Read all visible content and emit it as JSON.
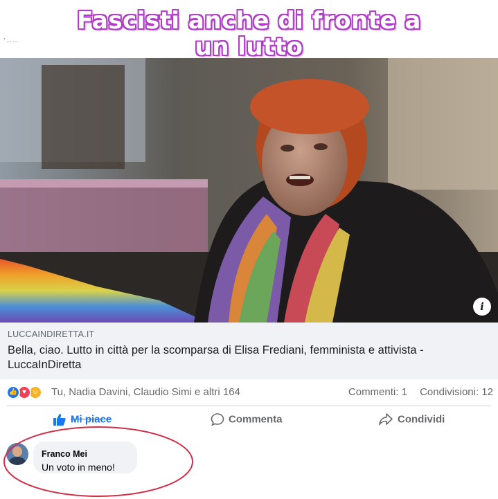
{
  "headline": {
    "line1": "Fascisti anche di fronte a",
    "line2": "un lutto",
    "tiny_text": "' ...  ..."
  },
  "post": {
    "link": {
      "domain": "LUCCAINDIRETTA.IT",
      "title": "Bella, ciao. Lutto in città per la scomparsa di Elisa Frediani, femminista e attivista - LuccaInDiretta",
      "info_icon": "info-icon"
    },
    "reactions": {
      "icons": [
        "like-icon",
        "love-icon",
        "care-icon"
      ],
      "names": "Tu, Nadia Davini, Claudio Simi e altri 164",
      "comments": "Commenti: 1",
      "shares": "Condivisioni: 12"
    },
    "actions": {
      "like": "Mi piace",
      "comment": "Commenta",
      "share": "Condividi"
    },
    "comment": {
      "author": "Franco Mei",
      "text": "Un voto in meno!"
    }
  },
  "colors": {
    "headline_outline": "#b03cc8",
    "facebook_blue": "#1877f2",
    "annotation_red": "#d0304a",
    "link_box_bg": "#f0f2f5"
  }
}
